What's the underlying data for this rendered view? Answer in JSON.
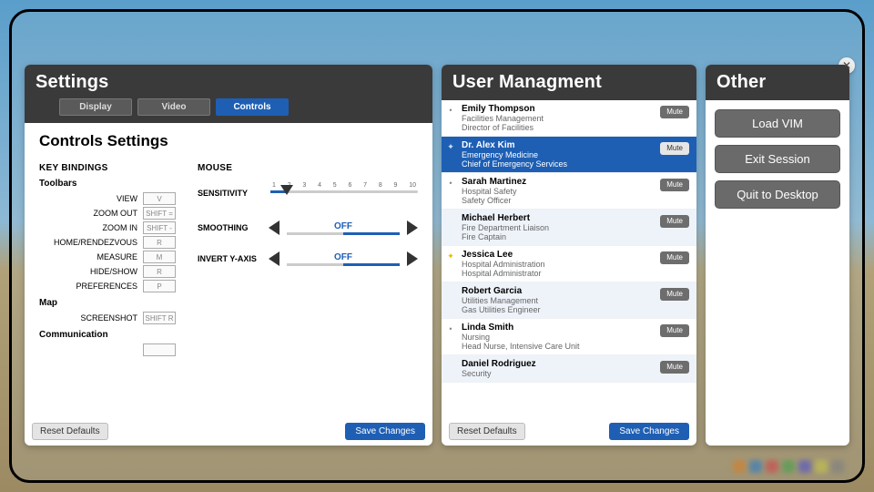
{
  "settings": {
    "title": "Settings",
    "tabs": [
      "Display",
      "Video",
      "Controls"
    ],
    "active_tab": 2,
    "subtitle": "Controls Settings",
    "keybindings_header": "KEY BINDINGS",
    "toolbars_header": "Toolbars",
    "map_header": "Map",
    "comm_header": "Communication",
    "kb_toolbar": [
      {
        "label": "VIEW",
        "key": "V"
      },
      {
        "label": "ZOOM OUT",
        "key": "SHIFT ="
      },
      {
        "label": "ZOOM IN",
        "key": "SHIFT -"
      },
      {
        "label": "HOME/RENDEZVOUS",
        "key": "R"
      },
      {
        "label": "MEASURE",
        "key": "M"
      },
      {
        "label": "HIDE/SHOW",
        "key": "R"
      },
      {
        "label": "PREFERENCES",
        "key": "P"
      }
    ],
    "kb_map": [
      {
        "label": "SCREENSHOT",
        "key": "SHIFT R"
      }
    ],
    "mouse_header": "MOUSE",
    "sensitivity_label": "SENSITIVITY",
    "sensitivity_ticks": [
      "1",
      "2",
      "3",
      "4",
      "5",
      "6",
      "7",
      "8",
      "9",
      "10"
    ],
    "sensitivity_value": 2,
    "smoothing_label": "SMOOTHING",
    "smoothing_value": "OFF",
    "invert_label": "INVERT Y-AXIS",
    "invert_value": "OFF",
    "reset_label": "Reset Defaults",
    "save_label": "Save Changes"
  },
  "users": {
    "title": "User Managment",
    "mute_label": "Mute",
    "reset_label": "Reset Defaults",
    "save_label": "Save Changes",
    "list": [
      {
        "name": "Emily Thompson",
        "dept": "Facilities Management",
        "role": "Director of Facilities",
        "icon": "dot",
        "selected": false,
        "alt": false
      },
      {
        "name": "Dr. Alex Kim",
        "dept": "Emergency Medicine",
        "role": "Chief of Emergency Services",
        "icon": "plus",
        "selected": true,
        "alt": false
      },
      {
        "name": "Sarah Martinez",
        "dept": "Hospital Safety",
        "role": "Safety Officer",
        "icon": "dot",
        "selected": false,
        "alt": false
      },
      {
        "name": "Michael Herbert",
        "dept": "Fire Department Liaison",
        "role": "Fire Captain",
        "icon": "none",
        "selected": false,
        "alt": true
      },
      {
        "name": "Jessica Lee",
        "dept": "Hospital Administration",
        "role": "Hospital Administrator",
        "icon": "star",
        "selected": false,
        "alt": false
      },
      {
        "name": "Robert Garcia",
        "dept": "Utilities Management",
        "role": "Gas Utilities Engineer",
        "icon": "none",
        "selected": false,
        "alt": true
      },
      {
        "name": "Linda Smith",
        "dept": "Nursing",
        "role": "Head Nurse, Intensive Care Unit",
        "icon": "dot",
        "selected": false,
        "alt": false
      },
      {
        "name": "Daniel Rodriguez",
        "dept": "Security",
        "role": "",
        "icon": "none",
        "selected": false,
        "alt": true
      }
    ]
  },
  "other": {
    "title": "Other",
    "buttons": [
      "Load VIM",
      "Exit Session",
      "Quit to Desktop"
    ]
  },
  "taskbar_colors": [
    "#d08030",
    "#3a7dbb",
    "#c94f4f",
    "#4f9f4f",
    "#5a5ac0",
    "#c0c050",
    "#808080"
  ]
}
